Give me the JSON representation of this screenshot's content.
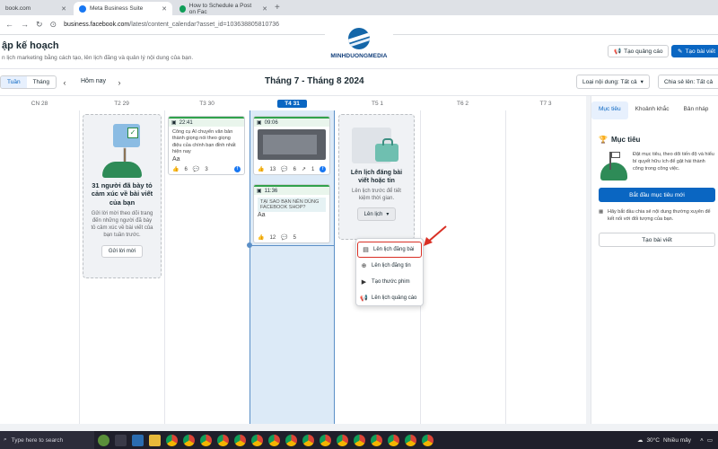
{
  "browser": {
    "tabs": [
      {
        "label": "book.com",
        "active": false
      },
      {
        "label": "Meta Business Suite",
        "active": true
      },
      {
        "label": "How to Schedule a Post on Fac",
        "active": false
      }
    ],
    "url_host": "business.facebook.com",
    "url_path": "/latest/content_calendar?asset_id=103638805810736"
  },
  "header": {
    "title": "ập kế hoạch",
    "subtitle": "n lịch marketing bằng cách tạo, lên lịch đăng và quản lý nội dung của bạn.",
    "logo_text": "MINHDUONGMEDIA",
    "create_ad_label": "Tạo quảng cáo",
    "create_post_label": "Tạo bài viết"
  },
  "toolbar": {
    "view_week": "Tuần",
    "view_month": "Tháng",
    "today_label": "Hôm nay",
    "range_label": "Tháng 7 - Tháng 8 2024",
    "content_type_label": "Loại nội dung: Tất cả",
    "share_label": "Chia sẻ lên: Tất cả"
  },
  "calendar": {
    "days": [
      "CN 28",
      "T2 29",
      "T3 30",
      "T4 31",
      "T5 1",
      "T6 2",
      "T7 3"
    ],
    "today_index": 3,
    "promo_feedback": {
      "title": "31 người đã bày tỏ cảm xúc về bài viết của bạn",
      "desc": "Gửi lời mời theo dõi trang đến những người đã bày tỏ cảm xúc về bài viết của bạn tuần trước.",
      "button": "Gửi lời mời"
    },
    "posts": [
      {
        "time": "22:41",
        "text": "Công cụ AI chuyển văn bản thành giọng nói theo giọng điệu của chính bạn đỉnh nhất hiện nay",
        "aa": "Aa",
        "likes": "6",
        "comments": "3"
      },
      {
        "time": "09:06",
        "likes": "13",
        "comments": "6",
        "shares": "1"
      },
      {
        "time": "11:36",
        "text": "TẠI SAO BẠN NÊN DÙNG FACEBOOK SHOP?",
        "aa": "Aa",
        "likes": "12",
        "comments": "5"
      }
    ],
    "promo_schedule": {
      "title": "Lên lịch đăng bài viết hoặc tin",
      "desc": "Lên lịch trước để tiết kiệm thời gian.",
      "button": "Lên lịch"
    },
    "menu": [
      {
        "label": "Lên lịch đăng bài",
        "icon": "post-icon",
        "highlighted": true
      },
      {
        "label": "Lên lịch đăng tin",
        "icon": "story-icon",
        "highlighted": false
      },
      {
        "label": "Tạo thước phim",
        "icon": "reel-icon",
        "highlighted": false
      },
      {
        "label": "Lên lịch quảng cáo",
        "icon": "megaphone-icon",
        "highlighted": false
      }
    ]
  },
  "right_panel": {
    "tabs": [
      "Mục tiêu",
      "Khoảnh khắc",
      "Bản nháp"
    ],
    "section_title": "Mục tiêu",
    "desc": "Đặt mục tiêu, theo dõi tiến độ và hiểu bí quyết hữu ích để gặt hái thành công trong công việc.",
    "primary_btn": "Bắt đầu mục tiêu mới",
    "desc2": "Hãy bắt đầu chia sẻ nội dung thường xuyên để kết nối với đối tượng của bạn.",
    "secondary_btn": "Tạo bài viết"
  },
  "taskbar": {
    "search_text": "Type here to search",
    "weather_temp": "30°C",
    "weather_desc": "Nhiều mây"
  },
  "colors": {
    "accent": "#0a66c2",
    "today_column": "#dceaf7",
    "published_green": "#31a24c",
    "highlight_red": "#d93025"
  }
}
